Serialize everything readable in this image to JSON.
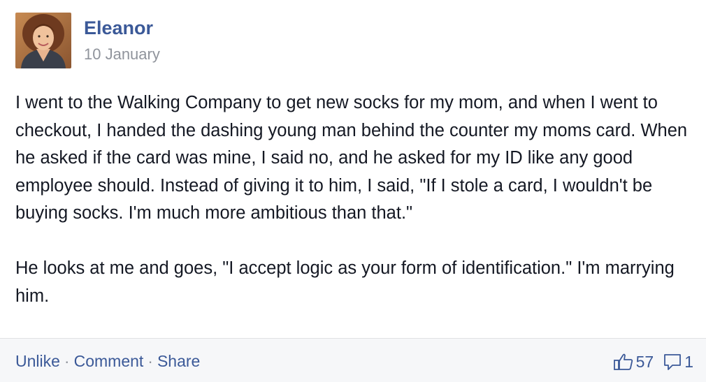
{
  "post": {
    "author": "Eleanor",
    "date": "10 January",
    "avatar": "profile-photo",
    "paragraphs": [
      "I went to the Walking Company to get new socks for my mom, and when I went to checkout, I handed the dashing young man behind the counter my moms card. When he asked if the card was mine, I said no, and he asked for my ID like any good employee should. Instead of giving it to him, I said, \"If I stole a card, I wouldn't be buying socks. I'm much more ambitious than that.\"",
      "He looks at me and goes, \"I accept logic as your form of identification.\" I'm marrying him."
    ]
  },
  "actions": {
    "unlike": "Unlike",
    "comment": "Comment",
    "share": "Share",
    "separator": "·"
  },
  "stats": {
    "likes": "57",
    "comments": "1",
    "like_icon": "thumbs-up-icon",
    "comment_icon": "comment-bubble-icon"
  },
  "colors": {
    "link": "#3b5998",
    "muted": "#90949c",
    "text": "#141823",
    "footer_bg": "#f6f7f9"
  }
}
